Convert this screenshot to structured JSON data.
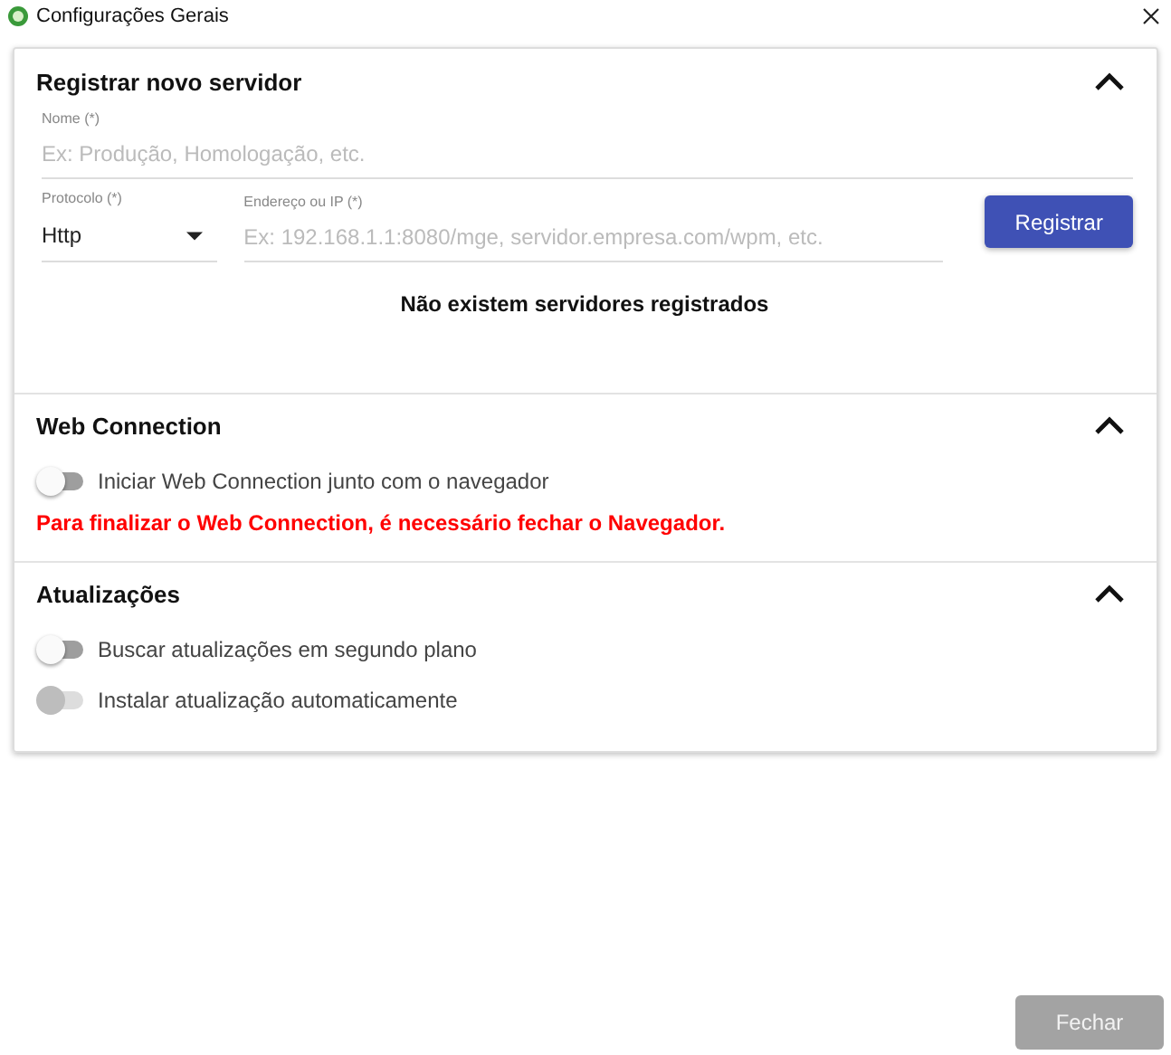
{
  "window": {
    "title": "Configurações Gerais"
  },
  "register": {
    "title": "Registrar novo servidor",
    "expanded": true,
    "name_field": {
      "label": "Nome (*)",
      "placeholder": "Ex: Produção, Homologação, etc."
    },
    "protocol_field": {
      "label": "Protocolo (*)",
      "value": "Http"
    },
    "address_field": {
      "label": "Endereço ou IP (*)",
      "placeholder": "Ex: 192.168.1.1:8080/mge, servidor.empresa.com/wpm, etc."
    },
    "button": "Registrar",
    "empty_message": "Não existem servidores registrados"
  },
  "sections": [
    {
      "title": "Web Connection",
      "expanded": true,
      "toggles": [
        {
          "label": "Iniciar Web Connection junto com o navegador",
          "on": false,
          "disabled": false
        }
      ],
      "warning": "Para finalizar o Web Connection, é necessário fechar o Navegador."
    },
    {
      "title": "Atualizações",
      "expanded": true,
      "toggles": [
        {
          "label": "Buscar atualizações em segundo plano",
          "on": false,
          "disabled": false
        },
        {
          "label": "Instalar atualização automaticamente",
          "on": false,
          "disabled": true
        }
      ]
    }
  ],
  "close_button": {
    "label": "Fechar",
    "disabled": true
  }
}
